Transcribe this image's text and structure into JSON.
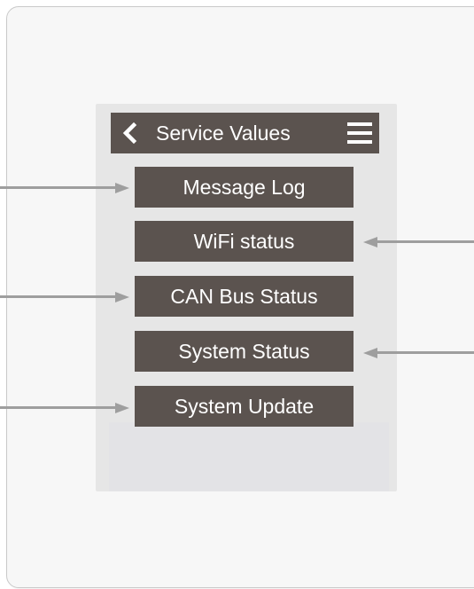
{
  "header": {
    "title": "Service Values"
  },
  "menu": [
    {
      "label": "Message Log"
    },
    {
      "label": "WiFi status"
    },
    {
      "label": "CAN Bus Status"
    },
    {
      "label": "System Status"
    },
    {
      "label": "System Update"
    }
  ],
  "icons": {
    "back": "chevron-left-icon",
    "menu": "hamburger-menu-icon"
  },
  "colors": {
    "button_bg": "#5b534f",
    "button_text": "#ffffff",
    "screen_bg": "#e6e6e6",
    "arrow": "#9e9e9e",
    "card_border": "#c9c9c9"
  }
}
